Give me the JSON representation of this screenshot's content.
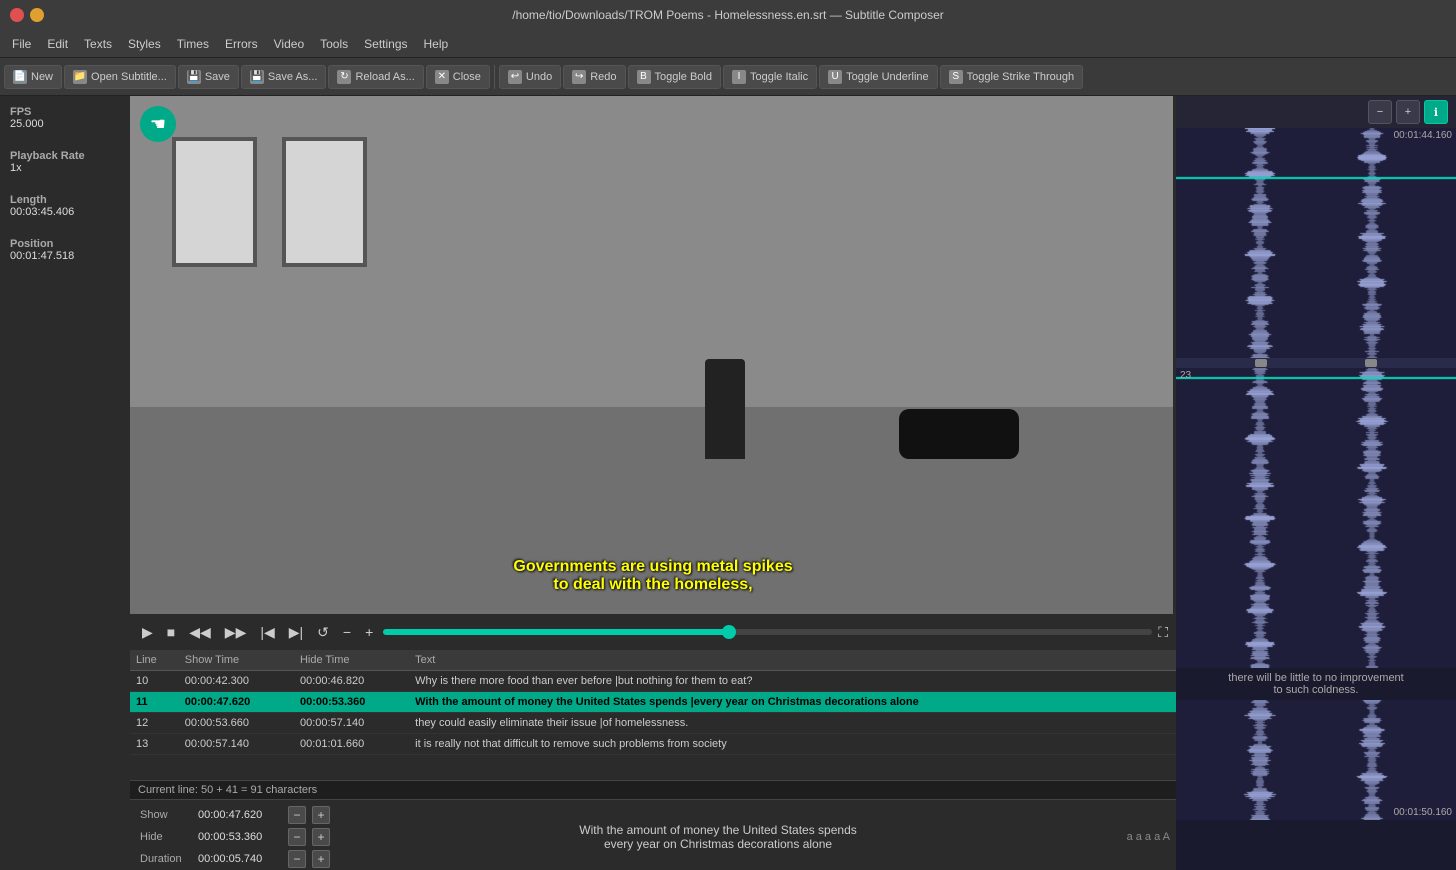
{
  "titlebar": {
    "title": "/home/tio/Downloads/TROM Poems - Homelessness.en.srt — Subtitle Composer"
  },
  "menubar": {
    "items": [
      "File",
      "Edit",
      "Texts",
      "Styles",
      "Times",
      "Errors",
      "Video",
      "Tools",
      "Settings",
      "Help"
    ]
  },
  "toolbar": {
    "buttons": [
      {
        "id": "new",
        "label": "New",
        "icon": "doc"
      },
      {
        "id": "open",
        "label": "Open Subtitle...",
        "icon": "folder"
      },
      {
        "id": "save",
        "label": "Save",
        "icon": "save"
      },
      {
        "id": "saveas",
        "label": "Save As...",
        "icon": "saveas"
      },
      {
        "id": "reloadas",
        "label": "Reload As...",
        "icon": "reload"
      },
      {
        "id": "close",
        "label": "Close",
        "icon": "x"
      },
      {
        "id": "undo",
        "label": "Undo",
        "icon": "undo"
      },
      {
        "id": "redo",
        "label": "Redo",
        "icon": "redo"
      },
      {
        "id": "bold",
        "label": "Toggle Bold",
        "icon": "B"
      },
      {
        "id": "italic",
        "label": "Toggle Italic",
        "icon": "I"
      },
      {
        "id": "underline",
        "label": "Toggle Underline",
        "icon": "U"
      },
      {
        "id": "strikethrough",
        "label": "Toggle Strike Through",
        "icon": "S"
      }
    ]
  },
  "left_panel": {
    "fps_label": "FPS",
    "fps_value": "25.000",
    "playback_rate_label": "Playback Rate",
    "playback_rate_value": "1x",
    "length_label": "Length",
    "length_value": "00:03:45.406",
    "position_label": "Position",
    "position_value": "00:01:47.518"
  },
  "video": {
    "subtitle_line1": "Governments are using metal spikes",
    "subtitle_line2": "to deal with the homeless,"
  },
  "subtitle_table": {
    "headers": [
      "Line",
      "Show Time",
      "Hide Time",
      "Text"
    ],
    "rows": [
      {
        "line": "10",
        "show": "00:00:42.300",
        "hide": "00:00:46.820",
        "text": "Why is there more food than ever before |but nothing for them to eat?",
        "active": false
      },
      {
        "line": "11",
        "show": "00:00:47.620",
        "hide": "00:00:53.360",
        "text": "With the amount of money the United States spends |every year on Christmas decorations alone",
        "active": true
      },
      {
        "line": "12",
        "show": "00:00:53.660",
        "hide": "00:00:57.140",
        "text": "they could easily eliminate their issue |of homelessness.",
        "active": false
      },
      {
        "line": "13",
        "show": "00:00:57.140",
        "hide": "00:01:01.660",
        "text": "it is really not that difficult to remove such problems from society",
        "active": false
      }
    ]
  },
  "status_bar": {
    "text": "Current line: 50 + 41 = 91 characters"
  },
  "edit": {
    "show_label": "Show",
    "show_value": "00:00:47.620",
    "hide_label": "Hide",
    "hide_value": "00:00:53.360",
    "duration_label": "Duration",
    "duration_value": "00:00:05.740",
    "preview_line1": "With the amount of money the United States spends",
    "preview_line2": "every year on Christmas decorations alone",
    "formatting_chars": "a a a a A"
  },
  "waveform": {
    "timestamp_top": "00:01:44.160",
    "segment_number": "23",
    "timestamp_bottom": "00:01:50.160",
    "caption": "there will be little to no improvement\nto such coldness."
  }
}
